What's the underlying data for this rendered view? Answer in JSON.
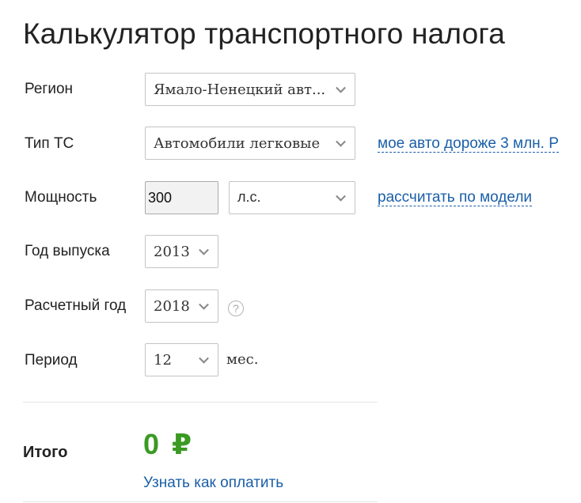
{
  "title": "Калькулятор транспортного налога",
  "fields": {
    "region": {
      "label": "Регион",
      "value": "Ямало-Ненецкий авт..."
    },
    "vehicle_type": {
      "label": "Тип ТС",
      "value": "Автомобили легковые",
      "link": "мое авто дороже 3 млн. Р"
    },
    "power": {
      "label": "Мощность",
      "value": "300",
      "unit": "л.с.",
      "link": "рассчитать по модели"
    },
    "year": {
      "label": "Год выпуска",
      "value": "2013"
    },
    "calc_year": {
      "label": "Расчетный год",
      "value": "2018",
      "help": "?"
    },
    "period": {
      "label": "Период",
      "value": "12",
      "unit": "мес."
    }
  },
  "total": {
    "label": "Итого",
    "amount": "0",
    "currency": "₽",
    "pay_link": "Узнать как оплатить"
  },
  "colors": {
    "accent_link": "#1a5fa8",
    "total_green": "#3a9a22"
  }
}
